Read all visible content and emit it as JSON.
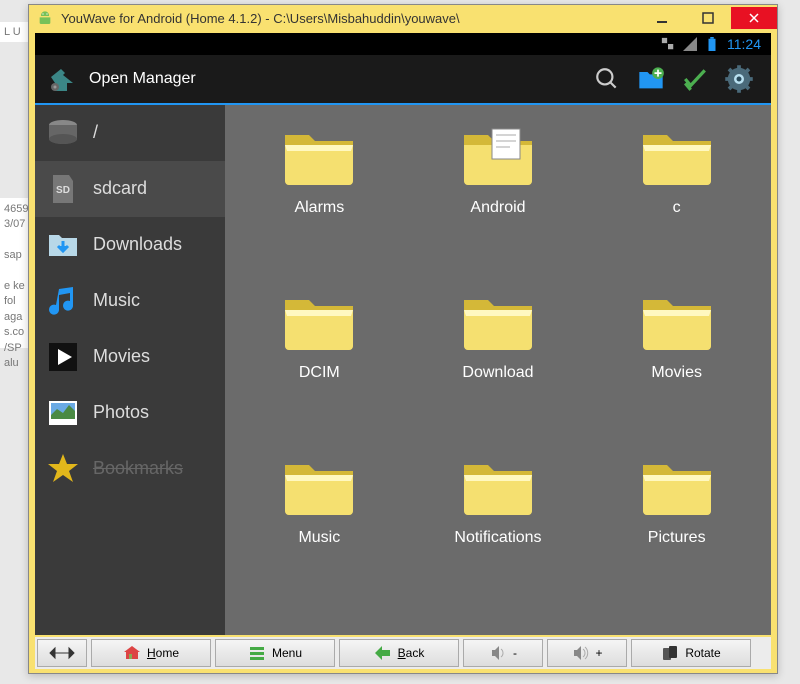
{
  "window": {
    "title": "YouWave for Android (Home 4.1.2) - C:\\Users\\Misbahuddin\\youwave\\"
  },
  "statusbar": {
    "time": "11:24"
  },
  "actionbar": {
    "title": "Open Manager"
  },
  "sidebar": {
    "items": [
      {
        "label": "/",
        "icon": "disk"
      },
      {
        "label": "sdcard",
        "icon": "sd",
        "active": true
      },
      {
        "label": "Downloads",
        "icon": "download"
      },
      {
        "label": "Music",
        "icon": "music"
      },
      {
        "label": "Movies",
        "icon": "play"
      },
      {
        "label": "Photos",
        "icon": "photo"
      },
      {
        "label": "Bookmarks",
        "icon": "star"
      }
    ]
  },
  "folders": [
    {
      "label": "Alarms",
      "type": "folder"
    },
    {
      "label": "Android",
      "type": "folder-doc"
    },
    {
      "label": "c",
      "type": "folder"
    },
    {
      "label": "DCIM",
      "type": "folder"
    },
    {
      "label": "Download",
      "type": "folder"
    },
    {
      "label": "Movies",
      "type": "folder"
    },
    {
      "label": "Music",
      "type": "folder"
    },
    {
      "label": "Notifications",
      "type": "folder"
    },
    {
      "label": "Pictures",
      "type": "folder"
    }
  ],
  "bottombar": {
    "home": "Home",
    "menu": "Menu",
    "back": "Back",
    "vol_minus": "-",
    "vol_plus": "+",
    "rotate": "Rotate"
  }
}
